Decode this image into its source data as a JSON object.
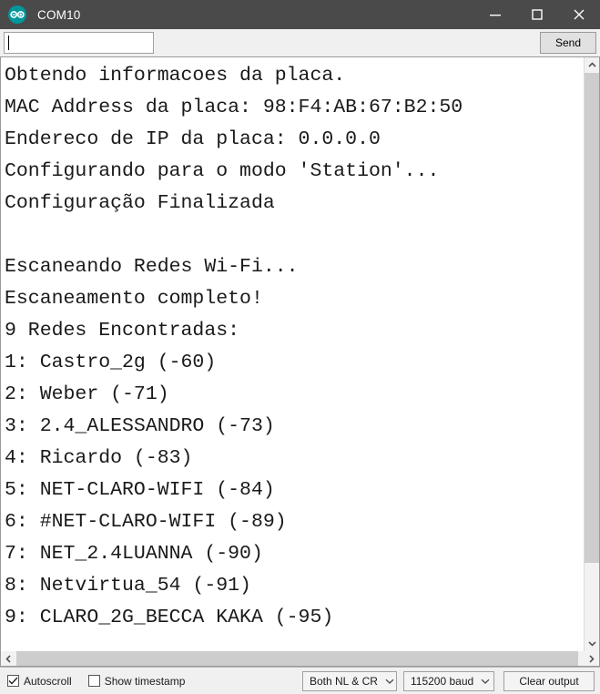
{
  "window": {
    "title": "COM10",
    "logo_icon": "arduino-infinity-icon",
    "minimize_icon": "minimize-icon",
    "maximize_icon": "maximize-icon",
    "close_icon": "close-icon"
  },
  "command_row": {
    "input_value": "",
    "input_placeholder": "",
    "send_label": "Send"
  },
  "console": {
    "text": "Obtendo informacoes da placa.\nMAC Address da placa: 98:F4:AB:67:B2:50\nEndereco de IP da placa: 0.0.0.0\nConfigurando para o modo 'Station'...\nConfiguração Finalizada\n\nEscaneando Redes Wi-Fi...\nEscaneamento completo!\n9 Redes Encontradas:\n1: Castro_2g (-60)\n2: Weber (-71)\n3: 2.4_ALESSANDRO (-73)\n4: Ricardo (-83)\n5: NET-CLARO-WIFI (-84)\n6: #NET-CLARO-WIFI (-89)\n7: NET_2.4LUANNA (-90)\n8: Netvirtua_54 (-91)\n9: CLARO_2G_BECCA KAKA (-95)",
    "lines": [
      "Obtendo informacoes da placa.",
      "MAC Address da placa: 98:F4:AB:67:B2:50",
      "Endereco de IP da placa: 0.0.0.0",
      "Configurando para o modo 'Station'...",
      "Configuração Finalizada",
      "",
      "Escaneando Redes Wi-Fi...",
      "Escaneamento completo!",
      "9 Redes Encontradas:",
      "1: Castro_2g (-60)",
      "2: Weber (-71)",
      "3: 2.4_ALESSANDRO (-73)",
      "4: Ricardo (-83)",
      "5: NET-CLARO-WIFI (-84)",
      "6: #NET-CLARO-WIFI (-89)",
      "7: NET_2.4LUANNA (-90)",
      "8: Netvirtua_54 (-91)",
      "9: CLARO_2G_BECCA KAKA (-95)"
    ],
    "board_info": {
      "mac_address": "98:F4:AB:67:B2:50",
      "ip_address": "0.0.0.0",
      "mode": "Station",
      "networks_found": 9
    },
    "networks": [
      {
        "index": "1",
        "ssid": "Castro_2g",
        "rssi": "-60"
      },
      {
        "index": "2",
        "ssid": "Weber",
        "rssi": "-71"
      },
      {
        "index": "3",
        "ssid": "2.4_ALESSANDRO",
        "rssi": "-73"
      },
      {
        "index": "4",
        "ssid": "Ricardo",
        "rssi": "-83"
      },
      {
        "index": "5",
        "ssid": "NET-CLARO-WIFI",
        "rssi": "-84"
      },
      {
        "index": "6",
        "ssid": "#NET-CLARO-WIFI",
        "rssi": "-89"
      },
      {
        "index": "7",
        "ssid": "NET_2.4LUANNA",
        "rssi": "-90"
      },
      {
        "index": "8",
        "ssid": "Netvirtua_54",
        "rssi": "-91"
      },
      {
        "index": "9",
        "ssid": "CLARO_2G_BECCA KAKA",
        "rssi": "-95"
      }
    ]
  },
  "scrollbars": {
    "vertical_up_icon": "chevron-up-icon",
    "vertical_down_icon": "chevron-down-icon",
    "horizontal_left_icon": "chevron-left-icon",
    "horizontal_right_icon": "chevron-right-icon"
  },
  "statusbar": {
    "autoscroll_label": "Autoscroll",
    "autoscroll_checked": true,
    "timestamp_label": "Show timestamp",
    "timestamp_checked": false,
    "line_ending_value": "Both NL & CR",
    "baud_value": "115200 baud",
    "clear_label": "Clear output"
  },
  "colors": {
    "titlebar_bg": "#4a4a4a",
    "accent_teal": "#00979c",
    "console_bg": "#ffffff",
    "console_text": "#1a1a1a",
    "chrome_bg": "#f0f0f0",
    "scrollbar_thumb": "#cdcdcd"
  }
}
